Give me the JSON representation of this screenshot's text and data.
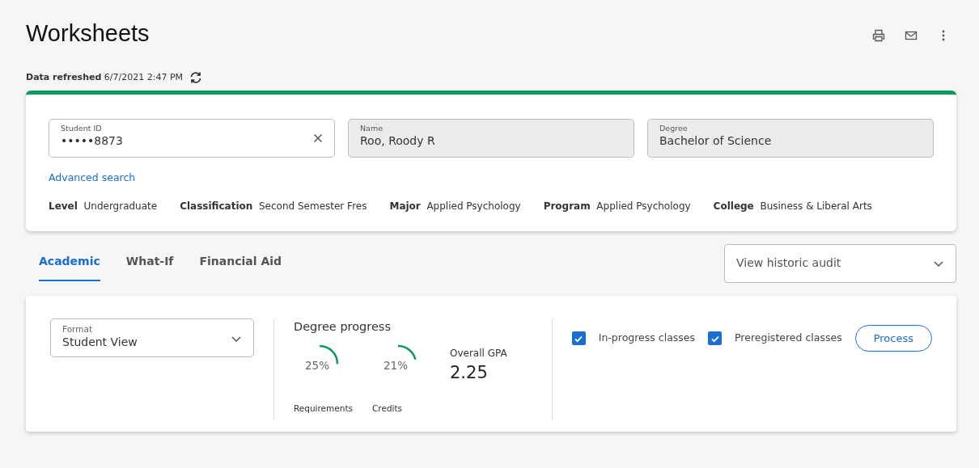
{
  "page": {
    "title": "Worksheets",
    "refreshed_label": "Data refreshed",
    "refreshed_time": "6/7/2021 2:47 PM"
  },
  "student": {
    "fields": [
      {
        "label": "Student ID",
        "value": "•••••8873",
        "clearable": true,
        "readonly": false
      },
      {
        "label": "Name",
        "value": "Roo, Roody R",
        "clearable": false,
        "readonly": true
      },
      {
        "label": "Degree",
        "value": "Bachelor of Science",
        "clearable": false,
        "readonly": true
      }
    ],
    "advanced_search": "Advanced search",
    "details": [
      {
        "label": "Level",
        "value": "Undergraduate"
      },
      {
        "label": "Classification",
        "value": "Second Semester Fres"
      },
      {
        "label": "Major",
        "value": "Applied Psychology"
      },
      {
        "label": "Program",
        "value": "Applied Psychology"
      },
      {
        "label": "College",
        "value": "Business & Liberal Arts"
      }
    ]
  },
  "tabs": [
    {
      "label": "Academic",
      "selected": true
    },
    {
      "label": "What-If",
      "selected": false
    },
    {
      "label": "Financial Aid",
      "selected": false
    }
  ],
  "historic_audit": {
    "placeholder": "View historic audit"
  },
  "audit": {
    "format": {
      "label": "Format",
      "value": "Student View"
    },
    "progress_title": "Degree progress",
    "gauges": [
      {
        "reading": "25%",
        "level": 0.25,
        "caption": "Requirements"
      },
      {
        "reading": "21%",
        "level": 0.21,
        "caption": "Credits"
      }
    ],
    "gpa": {
      "label": "Overall GPA",
      "value": "2.25"
    },
    "options": [
      {
        "label": "In-progress classes",
        "checked": true
      },
      {
        "label": "Preregistered classes",
        "checked": true
      }
    ],
    "process_button": "Process"
  }
}
